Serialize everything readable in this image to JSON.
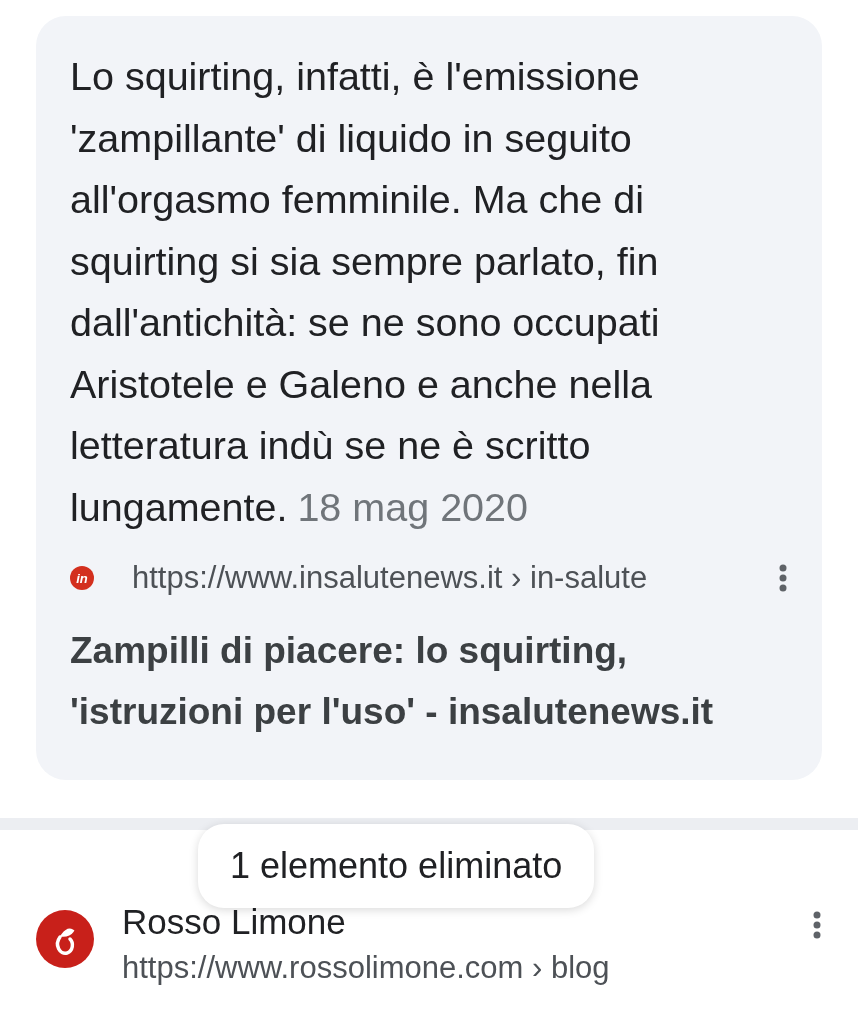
{
  "featured_snippet": {
    "text": "Lo squirting, infatti, è l'emissione 'zampillante' di liquido in seguito all'orgasmo femminile. Ma che di squirting si sia sempre parlato, fin dall'antichità: se ne sono occupati Aristotele e Galeno e anche nella letteratura indù se ne è scritto lungamente.",
    "date": "18 mag 2020",
    "source_url": "https://www.insalutenews.it › in-salute",
    "favicon_text": "in",
    "title": "Zampilli di piacere: lo squirting, 'istruzioni per l'uso' - insalutenews.it"
  },
  "results": [
    {
      "site_name": "Rosso Limone",
      "url": "https://www.rossolimone.com › blog"
    }
  ],
  "toast": {
    "text": "1 elemento eliminato"
  }
}
